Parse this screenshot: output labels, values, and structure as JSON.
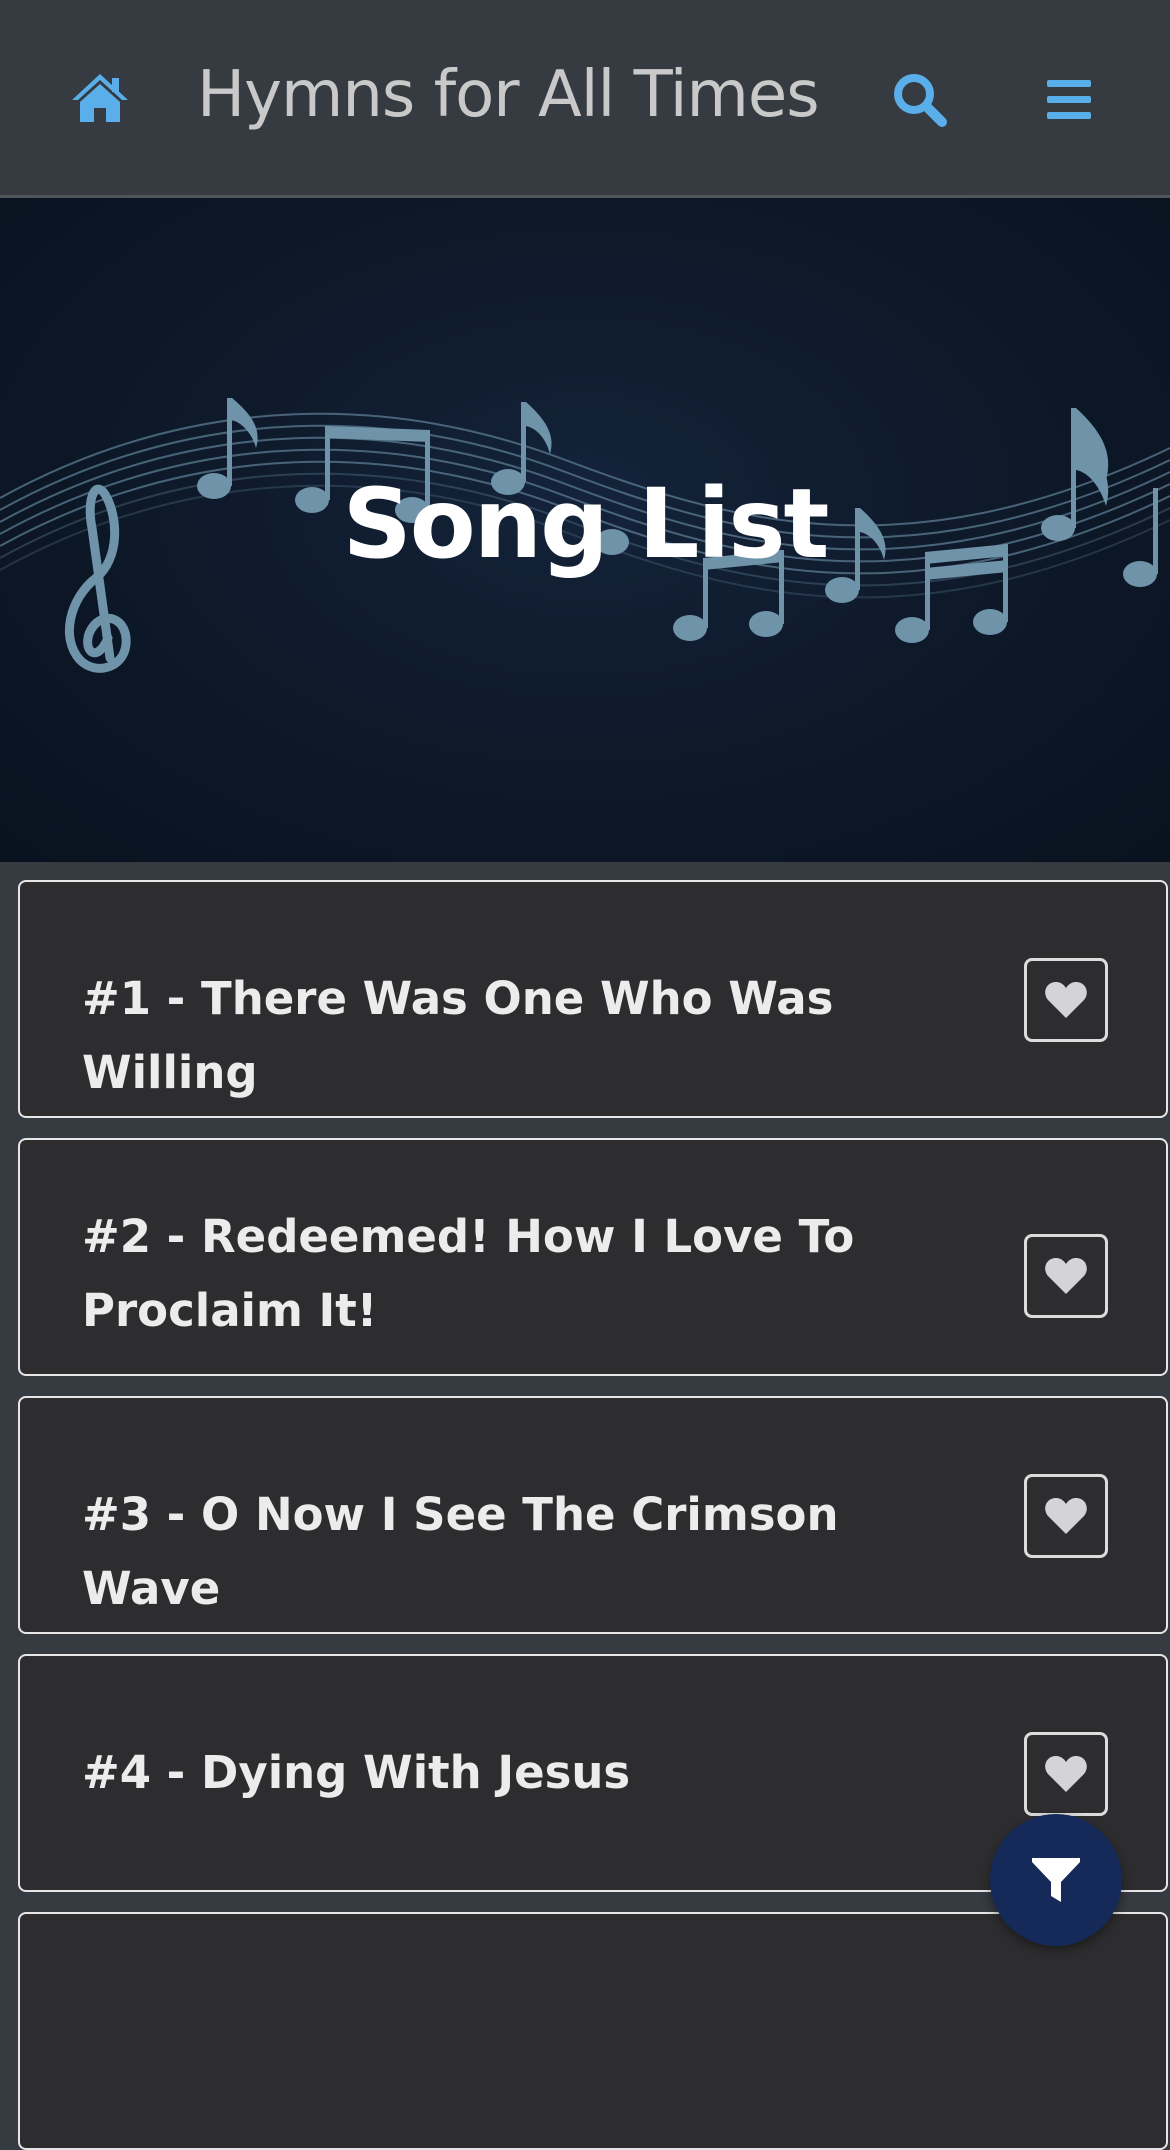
{
  "header": {
    "title": "Hymns for All Times",
    "home_icon": "home-icon",
    "search_icon": "search-icon",
    "menu_icon": "hamburger-menu-icon",
    "accent_color": "#5aaeea"
  },
  "hero": {
    "title": "Song List",
    "background_color": "#0d1828"
  },
  "songs": [
    {
      "label": "#1 - There Was One Who Was Willing",
      "favorite_icon": "heart-icon"
    },
    {
      "label": "#2 - Redeemed! How I Love To Proclaim It!",
      "favorite_icon": "heart-icon"
    },
    {
      "label": "#3 - O Now I See The Crimson Wave",
      "favorite_icon": "heart-icon"
    },
    {
      "label": "#4 - Dying With Jesus",
      "favorite_icon": "heart-icon"
    }
  ],
  "fab": {
    "icon": "filter-icon",
    "color": "#162a5a"
  }
}
